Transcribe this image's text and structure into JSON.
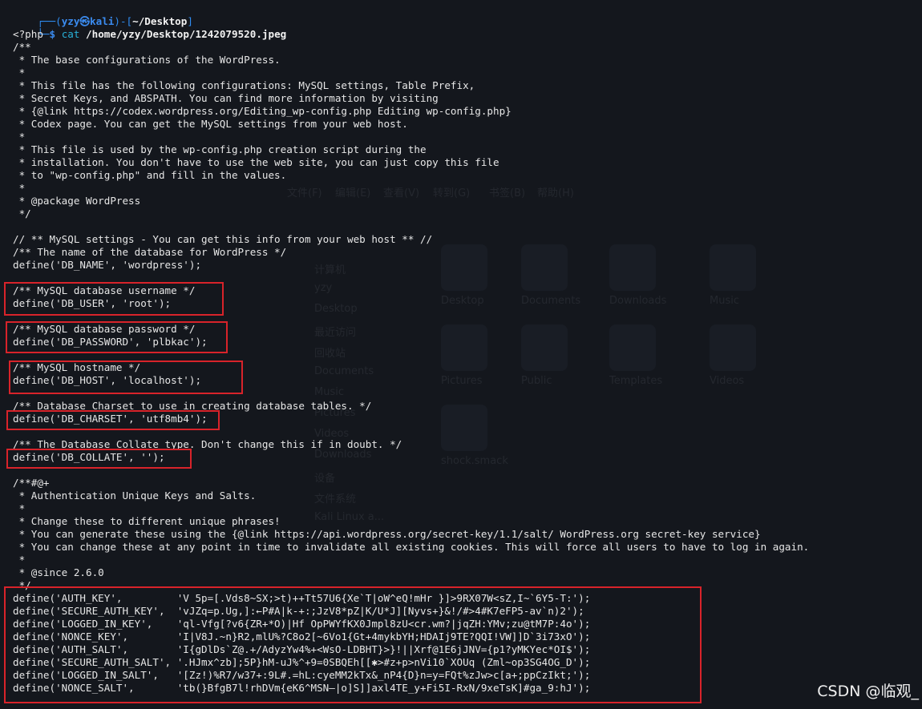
{
  "prompt": {
    "frame_top": "┌──(",
    "user_host": "yzy㉿kali",
    "frame_mid": ")-[",
    "cwd": "~/Desktop",
    "frame_end": "]",
    "frame_bottom": "└─",
    "dollar": "$",
    "command": "cat",
    "argument": "/home/yzy/Desktop/1242079520.jpeg"
  },
  "output_lines": [
    "<?php",
    "/**",
    " * The base configurations of the WordPress.",
    " *",
    " * This file has the following configurations: MySQL settings, Table Prefix,",
    " * Secret Keys, and ABSPATH. You can find more information by visiting",
    " * {@link https://codex.wordpress.org/Editing_wp-config.php Editing wp-config.php}",
    " * Codex page. You can get the MySQL settings from your web host.",
    " *",
    " * This file is used by the wp-config.php creation script during the",
    " * installation. You don't have to use the web site, you can just copy this file",
    " * to \"wp-config.php\" and fill in the values.",
    " *",
    " * @package WordPress",
    " */",
    "",
    "// ** MySQL settings - You can get this info from your web host ** //",
    "/** The name of the database for WordPress */",
    "define('DB_NAME', 'wordpress');",
    "",
    "/** MySQL database username */",
    "define('DB_USER', 'root');",
    "",
    "/** MySQL database password */",
    "define('DB_PASSWORD', 'plbkac');",
    "",
    "/** MySQL hostname */",
    "define('DB_HOST', 'localhost');",
    "",
    "/** Database Charset to use in creating database tables. */",
    "define('DB_CHARSET', 'utf8mb4');",
    "",
    "/** The Database Collate type. Don't change this if in doubt. */",
    "define('DB_COLLATE', '');",
    "",
    "/**#@+",
    " * Authentication Unique Keys and Salts.",
    " *",
    " * Change these to different unique phrases!",
    " * You can generate these using the {@link https://api.wordpress.org/secret-key/1.1/salt/ WordPress.org secret-key service}",
    " * You can change these at any point in time to invalidate all existing cookies. This will force all users to have to log in again.",
    " *",
    " * @since 2.6.0",
    " */",
    "define('AUTH_KEY',         'V 5p=[.Vds8~SX;>t)++Tt57U6{Xe`T|oW^eQ!mHr }]>9RX07W<sZ,I~`6Y5-T:');",
    "define('SECURE_AUTH_KEY',  'vJZq=p.Ug,]:←P#A|k-+:;JzV8*pZ|K/U*J][Nyvs+}&!/#>4#K7eFP5-av`n)2');",
    "define('LOGGED_IN_KEY',    'ql-Vfg[?v6{ZR+*O)|Hf OpPWYfKX0Jmpl8zU<cr.wm?|jqZH:YMv;zu@tM7P:4o');",
    "define('NONCE_KEY',        'I|V8J.~n}R2,mlU%?C8o2[~6Vo1{Gt+4mykbYH;HDAIj9TE?QQI!VW]]D`3i73xO');",
    "define('AUTH_SALT',        'I{gDlDs`Z@.+/AdyzYw4%+<WsO-LDBHT}>}!||Xrf@1E6jJNV={p1?yMKYec*OI$');",
    "define('SECURE_AUTH_SALT', '.HJmx^zb];5P}hM-uJ%^+9=0SBQEh[[✱>#z+p>nVi10`XOUq (Zml~op3SG4OG_D');",
    "define('LOGGED_IN_SALT',   '[Zz!)%R7/w37+:9L#.=hL:cyeMM2kTx&_nP4{D}n=y=FQt%zJw>c[a+;ppCzIkt;');",
    "define('NONCE_SALT',       'tb(}BfgB7l!rhDVm{eK6^MSN—|o]S]]axl4TE_y+Fi5I-RxN/9xeTsK]#ga_9:hJ');"
  ],
  "background_labels": {
    "menu": [
      "文件(F)",
      "编辑(E)",
      "查看(V)",
      "转到(G)",
      "书签(B)",
      "帮助(H)"
    ],
    "sidebar": [
      "计算机",
      "yzy",
      "Desktop",
      "最近访问",
      "回收站",
      "Documents",
      "Music",
      "Pictures",
      "Videos",
      "Downloads",
      "设备",
      "文件系统",
      "Kali Linux a..."
    ],
    "tiles": [
      "Desktop",
      "Documents",
      "Downloads",
      "Music",
      "Pictures",
      "Public",
      "Templates",
      "Videos",
      "shock.smack"
    ]
  },
  "watermark": "CSDN @临观_",
  "colors": {
    "background": "#14171d",
    "prompt_frame": "#2f8df2",
    "command": "#28b0d7",
    "text": "#e6e6e6",
    "highlight_box": "#d8232a"
  }
}
